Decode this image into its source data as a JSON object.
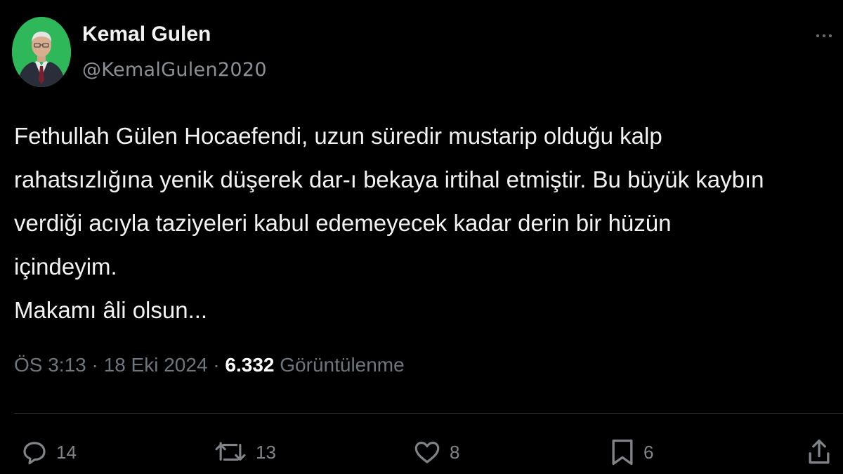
{
  "author": {
    "name": "Kemal Gulen",
    "handle": "@KemalGulen2020"
  },
  "tweet": {
    "lines": [
      "Fethullah Gülen Hocaefendi, uzun süredir mustarip olduğu kalp",
      "rahatsızlığına yenik düşerek dar-ı bekaya irtihal etmiştir. Bu büyük kaybın",
      "verdiği acıyla taziyeleri kabul edemeyecek kadar derin bir hüzün",
      "içindeyim.",
      "Makamı âli olsun..."
    ]
  },
  "meta": {
    "time": "ÖS 3:13",
    "separator": "·",
    "date": "18 Eki 2024",
    "views_count": "6.332",
    "views_label": "Görüntülenme"
  },
  "actions": {
    "replies": "14",
    "retweets": "13",
    "likes": "8",
    "bookmarks": "6"
  },
  "icons": {
    "more": "more-horizontal-icon",
    "reply": "reply-icon",
    "retweet": "retweet-icon",
    "like": "heart-icon",
    "bookmark": "bookmark-icon",
    "share": "share-icon"
  },
  "colors": {
    "background": "#000000",
    "text": "#f2f2f2",
    "secondary": "#6e767d",
    "avatar_bg": "#2fb85a"
  }
}
